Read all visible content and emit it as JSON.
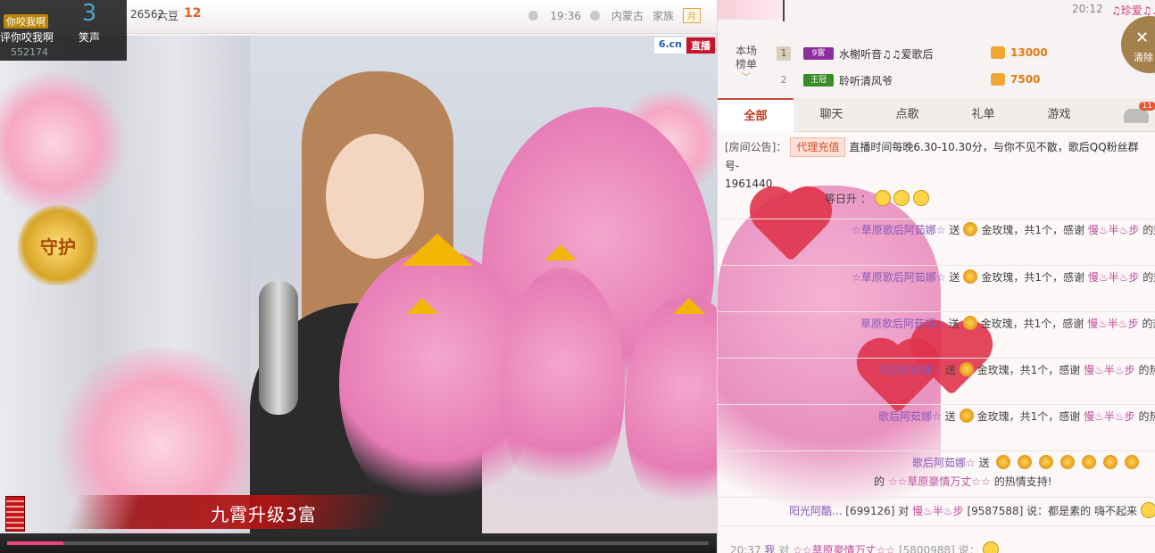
{
  "topbar": {
    "room_id": "26562",
    "beans_label": "六豆",
    "beans_count": "12",
    "time": "19:36",
    "location": "内蒙古",
    "family_label": "家族",
    "month_badge": "月"
  },
  "overlay": {
    "button_label": "你咬我啊",
    "left_label": "评你咬我啊",
    "laugh_count": "3",
    "laugh_label": "笑声",
    "fans": "552174"
  },
  "video": {
    "logo_left": "6.cn",
    "logo_right": "直播",
    "guard_badge": "守护",
    "upgrade_text": "九霄升级3富",
    "progress": 0.08
  },
  "right_top": {
    "time": "20:12",
    "nick": "♫珍爱♫♫",
    "clear_label": "清除",
    "clear_icon": "close-icon"
  },
  "rank": {
    "title_line1": "本场",
    "title_line2": "榜单",
    "rows": [
      {
        "num": "1",
        "level": "9富",
        "level_color": "#8e2d9e",
        "name": "水榭听音♫♫爱歌后",
        "value": "13000"
      },
      {
        "num": "2",
        "level": "王冠",
        "level_color": "#3a8a2a",
        "name": "聆听清风爷",
        "value": "7500"
      }
    ]
  },
  "tabs": [
    {
      "label": "全部",
      "active": true
    },
    {
      "label": "聊天",
      "active": false
    },
    {
      "label": "点歌",
      "active": false
    },
    {
      "label": "礼单",
      "active": false
    },
    {
      "label": "游戏",
      "active": false
    }
  ],
  "car_badge": "11",
  "chat": {
    "notice_tag": "[房间公告]：",
    "notice_agent": "代理充值",
    "notice_text": "直播时间每晚6.30-10.30分，与你不见不散，歌后QQ粉丝群号-",
    "notice_line2": "1961440",
    "rise_text": "等日升 ：",
    "gift_messages": [
      {
        "sender": "☆草原歌后阿茹娜☆",
        "verb": "送",
        "gift": "金玫瑰，共1个，感谢",
        "receiver": "慢♨半♨步",
        "tail": "的热情支"
      },
      {
        "sender": "☆草原歌后阿茹娜☆",
        "verb": "送",
        "gift": "金玫瑰，共1个，感谢",
        "receiver": "慢♨半♨步",
        "tail": "的热情支"
      },
      {
        "sender": "草原歌后阿茹娜☆",
        "verb": "送",
        "gift": "金玫瑰，共1个，感谢",
        "receiver": "慢♨半♨步",
        "tail": "的热情支"
      },
      {
        "sender": "歌后阿茹娜☆",
        "verb": "送",
        "gift": "金玫瑰，共1个，感谢",
        "receiver": "慢♨半♨步",
        "tail": "的热情支"
      },
      {
        "sender": "歌后阿茹娜☆",
        "verb": "送",
        "gift": "金玫瑰，共1个，感谢",
        "receiver": "慢♨半♨步",
        "tail": "的热情支"
      }
    ],
    "multi_gift": {
      "sender": "歌后阿茹娜☆",
      "verb": "送"
    },
    "thanks_line": {
      "prefix": "的",
      "receiver": "☆☆草原豪情万丈☆☆",
      "suffix": "的热情支持!"
    },
    "say_line": {
      "sender": "阳光阿酷...",
      "sender_id": "[699126]",
      "to": "对",
      "receiver": "慢♨半♨步",
      "receiver_id": "[9587588]",
      "said": "说：都是素的 嗨不起来"
    },
    "last_line": {
      "time": "20:37",
      "sender": "我",
      "to": "对",
      "receiver": "☆☆草原豪情万丈☆☆",
      "receiver_id": "[5800988]",
      "said": "说："
    }
  }
}
